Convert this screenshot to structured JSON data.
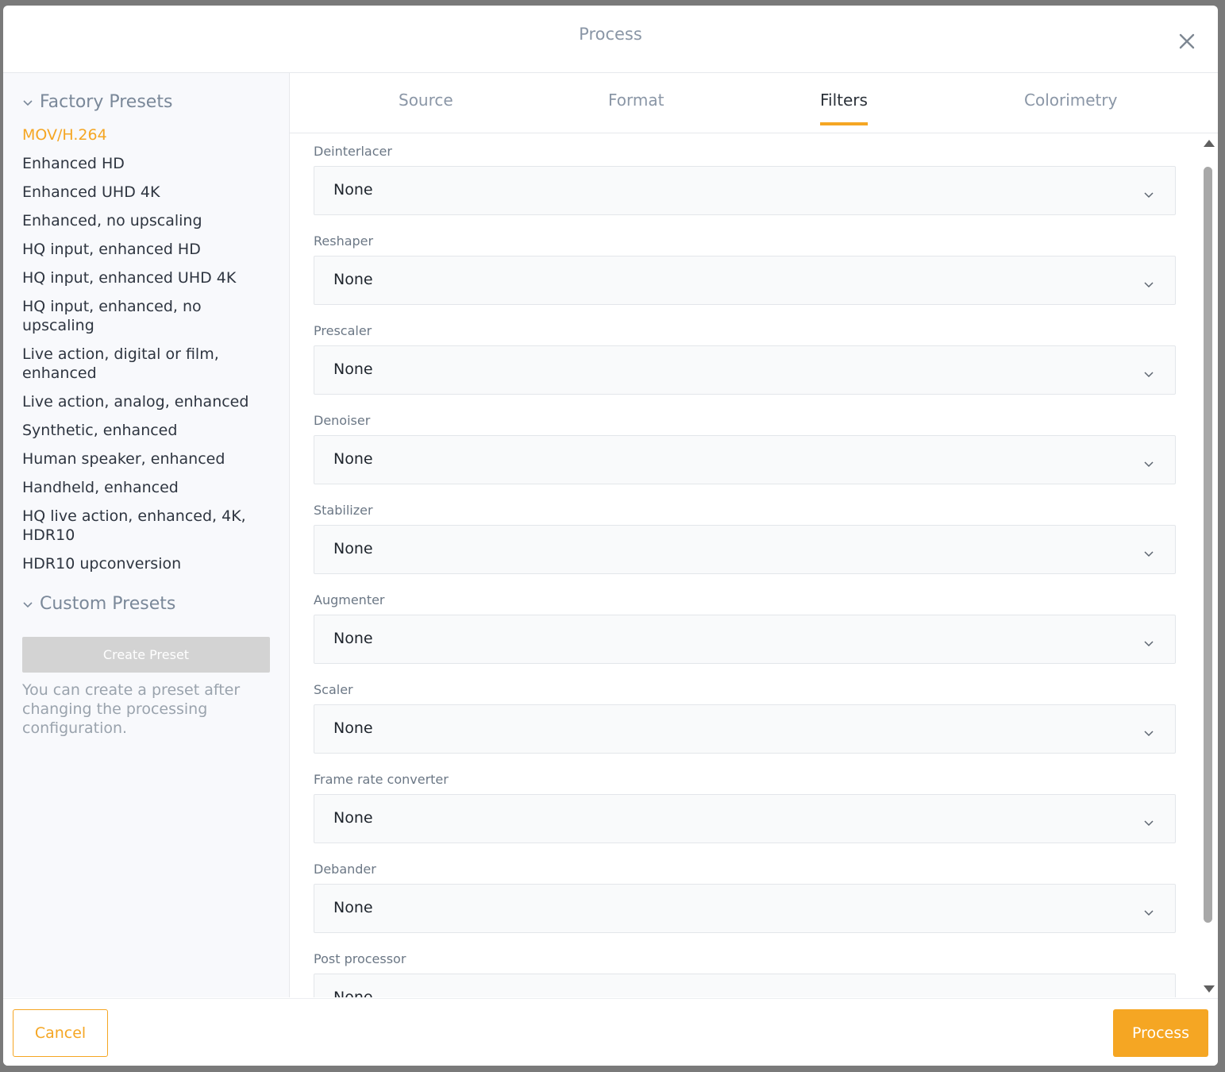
{
  "dialog": {
    "title": "Process"
  },
  "sidebar": {
    "factory_title": "Factory Presets",
    "factory_presets": [
      "MOV/H.264",
      "Enhanced HD",
      "Enhanced UHD 4K",
      "Enhanced, no upscaling",
      "HQ input, enhanced HD",
      "HQ input, enhanced UHD 4K",
      "HQ input, enhanced, no upscaling",
      "Live action, digital or film, enhanced",
      "Live action, analog, enhanced",
      "Synthetic, enhanced",
      "Human speaker, enhanced",
      "Handheld, enhanced",
      "HQ live action, enhanced, 4K, HDR10",
      "HDR10 upconversion"
    ],
    "active_preset": "MOV/H.264",
    "custom_title": "Custom Presets",
    "create_button": "Create Preset",
    "hint": "You can create a preset after changing the processing configuration."
  },
  "tabs": [
    {
      "label": "Source",
      "active": false
    },
    {
      "label": "Format",
      "active": false
    },
    {
      "label": "Filters",
      "active": true
    },
    {
      "label": "Colorimetry",
      "active": false
    }
  ],
  "filters": [
    {
      "label": "Deinterlacer",
      "value": "None"
    },
    {
      "label": "Reshaper",
      "value": "None"
    },
    {
      "label": "Prescaler",
      "value": "None"
    },
    {
      "label": "Denoiser",
      "value": "None"
    },
    {
      "label": "Stabilizer",
      "value": "None"
    },
    {
      "label": "Augmenter",
      "value": "None"
    },
    {
      "label": "Scaler",
      "value": "None"
    },
    {
      "label": "Frame rate converter",
      "value": "None"
    },
    {
      "label": "Debander",
      "value": "None"
    },
    {
      "label": "Post processor",
      "value": "None"
    }
  ],
  "footer": {
    "cancel": "Cancel",
    "process": "Process"
  },
  "colors": {
    "accent": "#f5a623",
    "text": "#2e3540",
    "muted": "#8a96a6"
  }
}
